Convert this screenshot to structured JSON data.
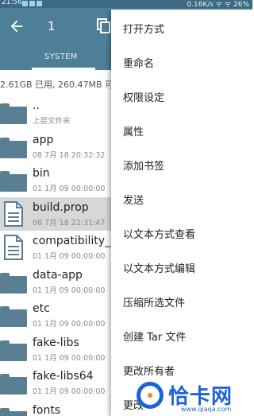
{
  "status_bar": {
    "time": "21:56",
    "right": "0.16K/s ᯤ ᯤ 26%"
  },
  "toolbar": {
    "selected_count": "1",
    "back_icon": "arrow-back-icon",
    "copy_icon": "copy-icon"
  },
  "path_bar": {
    "crumb": "SYSTEM"
  },
  "storage": {
    "info": "2.61GB 已用, 260.47MB 可"
  },
  "files": [
    {
      "name": "..",
      "meta": "上层文件夹",
      "type": "folder",
      "selected": false
    },
    {
      "name": "app",
      "meta": "08 7月 18 20:32:32",
      "type": "folder",
      "selected": false
    },
    {
      "name": "bin",
      "meta": "01 1月 09 00:00:00",
      "type": "folder",
      "selected": false
    },
    {
      "name": "build.prop",
      "meta": "08 7月 18 22:31:47",
      "type": "file",
      "selected": true
    },
    {
      "name": "compatibility_m",
      "meta": "01 1月 09 00:00:00",
      "type": "file",
      "selected": false
    },
    {
      "name": "data-app",
      "meta": "01 1月 09 00:00:00",
      "type": "folder",
      "selected": false
    },
    {
      "name": "etc",
      "meta": "01 1月 09 00:00:00",
      "type": "folder",
      "selected": false
    },
    {
      "name": "fake-libs",
      "meta": "01 1月 09 00:00:00",
      "type": "folder",
      "selected": false
    },
    {
      "name": "fake-libs64",
      "meta": "01 1月 09 00:00:00",
      "type": "folder",
      "selected": false
    },
    {
      "name": "fonts",
      "meta": "",
      "type": "folder",
      "selected": false
    }
  ],
  "menu": {
    "items": [
      "打开方式",
      "重命名",
      "权限设定",
      "属性",
      "添加书签",
      "发送",
      "以文本方式查看",
      "以文本方式编辑",
      "压缩所选文件",
      "创建 Tar 文件",
      "更改所有者",
      "更改"
    ]
  },
  "watermark": {
    "brand": "恰卡网",
    "domain": "www.qiaqa.com"
  },
  "colors": {
    "toolbar": "#4e7f99",
    "folder": "#5a7f93",
    "selected_row": "#d7d7d7",
    "watermark": "#1e63d6"
  }
}
